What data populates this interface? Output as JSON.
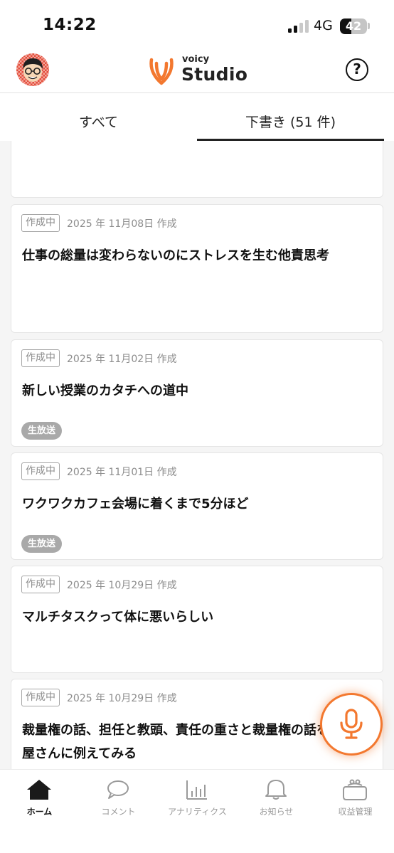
{
  "status_bar": {
    "time": "14:22",
    "network": "4G",
    "battery_level": "42",
    "battery_fraction": 0.42
  },
  "header": {
    "logo_small": "voicy",
    "logo_big": "Studio",
    "help_symbol": "?",
    "logo_color": "#f3782f"
  },
  "tabs": [
    {
      "label": "すべて",
      "active": false
    },
    {
      "label": "下書き (51 件)",
      "active": true
    }
  ],
  "cards": [
    {
      "status": "",
      "date": "",
      "title": "",
      "live": ""
    },
    {
      "status": "作成中",
      "date": "2025 年 11月08日 作成",
      "title": "仕事の総量は変わらないのにストレスを生む他責思考",
      "live": ""
    },
    {
      "status": "作成中",
      "date": "2025 年 11月02日 作成",
      "title": "新しい授業のカタチへの道中",
      "live": "生放送"
    },
    {
      "status": "作成中",
      "date": "2025 年 11月01日 作成",
      "title": "ワクワクカフェ会場に着くまで5分ほど",
      "live": "生放送"
    },
    {
      "status": "作成中",
      "date": "2025 年 10月29日 作成",
      "title": "マルチタスクって体に悪いらしい",
      "live": ""
    },
    {
      "status": "作成中",
      "date": "2025 年 10月29日 作成",
      "title": "裁量権の話、担任と教頭、責任の重さと裁量権の話を料理屋さんに例えてみる",
      "live": ""
    }
  ],
  "fab": {
    "icon": "microphone-icon",
    "color": "#f3782f"
  },
  "bottom_nav": [
    {
      "label": "ホーム",
      "icon": "home-icon",
      "active": true
    },
    {
      "label": "コメント",
      "icon": "comment-icon",
      "active": false
    },
    {
      "label": "アナリティクス",
      "icon": "analytics-icon",
      "active": false
    },
    {
      "label": "お知らせ",
      "icon": "bell-icon",
      "active": false
    },
    {
      "label": "収益管理",
      "icon": "wallet-icon",
      "active": false
    }
  ]
}
